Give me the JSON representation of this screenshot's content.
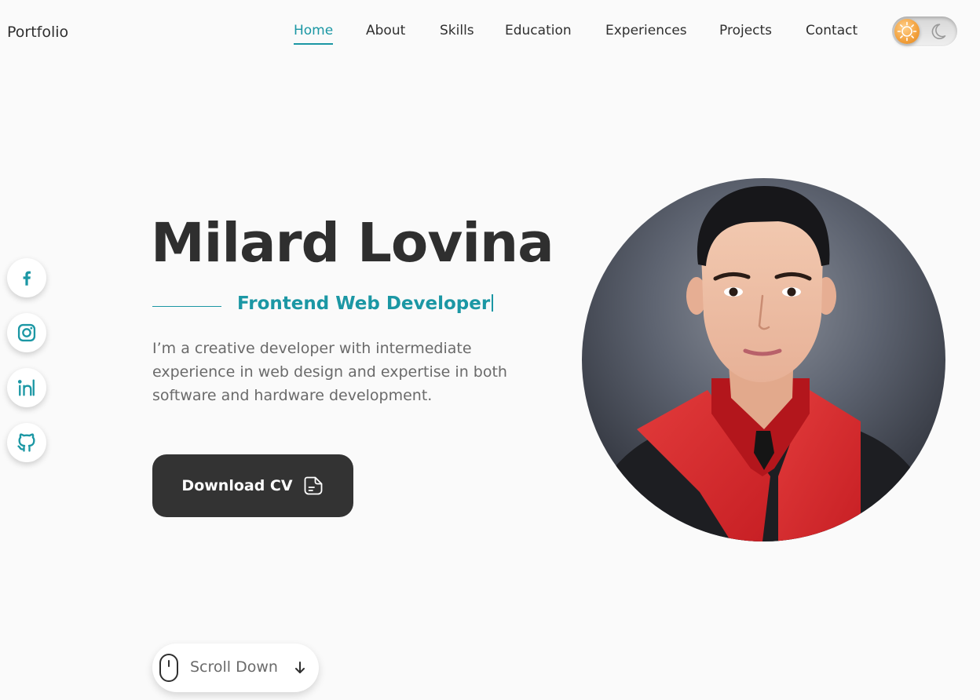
{
  "header": {
    "logo": "Portfolio",
    "nav": [
      "Home",
      "About",
      "Skills",
      "Education",
      "Experiences",
      "Projects",
      "Contact"
    ],
    "active_nav": "Home",
    "theme_icons": [
      "sun-icon",
      "moon-icon"
    ]
  },
  "social": [
    "facebook-icon",
    "instagram-icon",
    "linkedin-icon",
    "github-icon"
  ],
  "hero": {
    "name": "Milard Lovina",
    "subtitle": "Frontend Web Developer",
    "description": "I’m a creative developer with intermediate experience in web design and expertise in both software and hardware development.",
    "cta_label": "Download CV",
    "cta_icon": "document-icon"
  },
  "scroll": {
    "label": "Scroll Down",
    "icons": [
      "mouse-icon",
      "arrow-down-icon"
    ]
  },
  "colors": {
    "accent": "#1b97a4",
    "text": "#2f2f2f",
    "muted": "#6a6a6a",
    "button": "#333333",
    "background": "#fafafa"
  }
}
